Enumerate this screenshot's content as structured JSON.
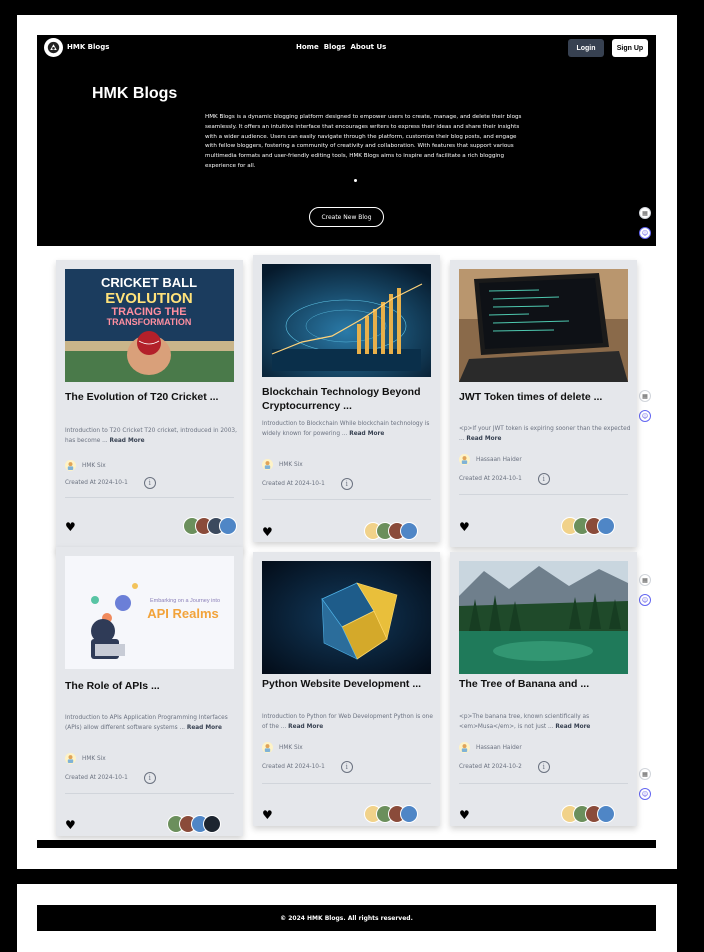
{
  "nav": {
    "brand": "HMK Blogs",
    "links": [
      "Home",
      "Blogs",
      "About Us"
    ],
    "login": "Login",
    "signup": "Sign Up"
  },
  "hero": {
    "title": "HMK Blogs",
    "description": "HMK Blogs is a dynamic blogging platform designed to empower users to create, manage, and delete their blogs seamlessly. It offers an intuitive interface that encourages writers to express their ideas and share their insights with a wider audience. Users can easily navigate through the platform, customize their blog posts, and engage with fellow bloggers, fostering a community of creativity and collaboration. With features that support various multimedia formats and user-friendly editing tools, HMK Blogs aims to inspire and facilitate a rich blogging experience for all.",
    "create_button": "Create New Blog"
  },
  "cards": [
    {
      "title": "The Evolution of T20 Cricket ...",
      "excerpt": "Introduction to T20 Cricket T20 cricket, introduced in 2003, has become ...",
      "read_more": "Read More",
      "author": "HMK Six",
      "date": "Created At 2024-10-1",
      "image_text": [
        "CRICKET BALL",
        "EVOLUTION",
        "TRACING THE",
        "TRANSFORMATION"
      ]
    },
    {
      "title": "Blockchain Technology Beyond Cryptocurrency ...",
      "excerpt": "Introduction to Blockchain While blockchain technology is widely known for powering ...",
      "read_more": "Read More",
      "author": "HMK Six",
      "date": "Created At 2024-10-1"
    },
    {
      "title": "JWT Token times of delete ...",
      "excerpt": "<p>If your JWT token is expiring sooner than the expected ...",
      "read_more": "Read More",
      "author": "Hassaan Haider",
      "date": "Created At 2024-10-1"
    },
    {
      "title": "The Role of APIs ...",
      "excerpt": "Introduction to APIs Application Programming Interfaces (APIs) allow different software systems ...",
      "read_more": "Read More",
      "author": "HMK Six",
      "date": "Created At 2024-10-1",
      "image_text": [
        "Embarking on a Journey into",
        "API Realms"
      ]
    },
    {
      "title": "Python Website Development ...",
      "excerpt": "Introduction to Python for Web Development Python is one of the ...",
      "read_more": "Read More",
      "author": "HMK Six",
      "date": "Created At 2024-10-1"
    },
    {
      "title": "The Tree of Banana and ...",
      "excerpt": "<p>The banana tree, known scientifically as <em>Musa</em>, is not just ...",
      "read_more": "Read More",
      "author": "Hassaan Haider",
      "date": "Created At 2024-10-2"
    }
  ],
  "footer": {
    "text": "© 2024 HMK Blogs. All rights reserved."
  },
  "icons": {
    "heart": "heart-icon",
    "info": "info-icon",
    "logo": "blog-logo-icon",
    "chatbot": "chatbot-icon",
    "grid": "grid-icon"
  }
}
